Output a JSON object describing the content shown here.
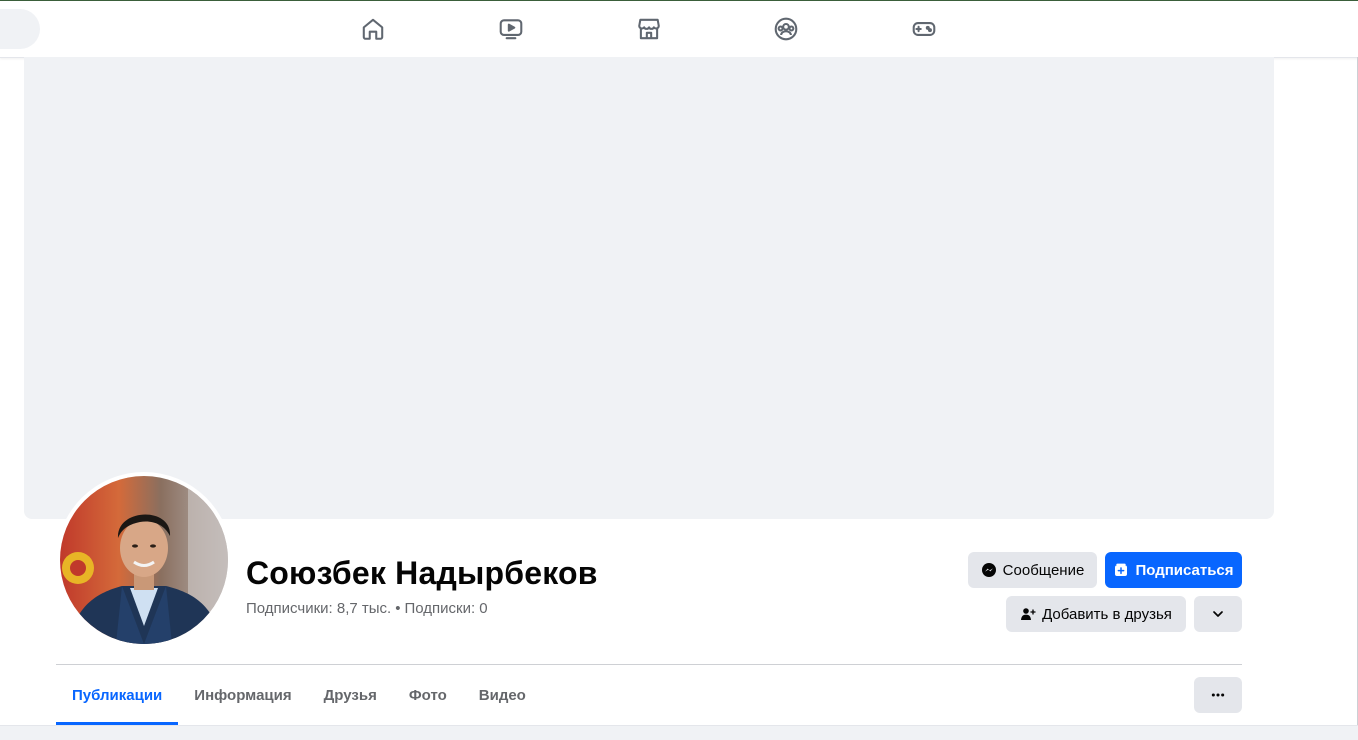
{
  "nav": {
    "icons": [
      "home-icon",
      "video-icon",
      "marketplace-icon",
      "groups-icon",
      "gaming-icon"
    ]
  },
  "profile": {
    "name": "Союзбек Надырбеков",
    "followers": "Подписчики: 8,7 тыс.",
    "separator": "•",
    "following": "Подписки: 0"
  },
  "actions": {
    "message_label": "Сообщение",
    "follow_label": "Подписаться",
    "add_friend_label": "Добавить в друзья"
  },
  "tabs": [
    {
      "label": "Публикации",
      "active": true
    },
    {
      "label": "Информация",
      "active": false
    },
    {
      "label": "Друзья",
      "active": false
    },
    {
      "label": "Фото",
      "active": false
    },
    {
      "label": "Видео",
      "active": false
    }
  ],
  "colors": {
    "accent": "#0866ff",
    "button_gray": "#e4e6eb",
    "secondary_text": "#65676b",
    "cover_bg": "#f0f2f5"
  }
}
